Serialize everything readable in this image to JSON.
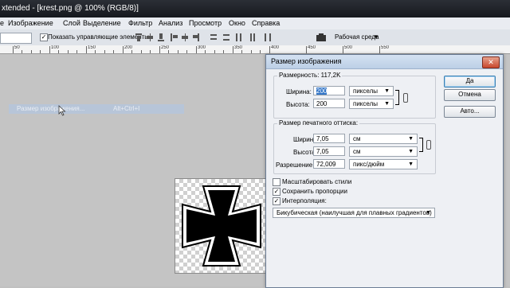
{
  "window": {
    "title": "xtended - [krest.png @ 100% (RGB/8)]"
  },
  "menu": [
    "Изображение",
    "Слой",
    "Выделение",
    "Фильтр",
    "Анализ",
    "Просмотр",
    "Окно",
    "Справка"
  ],
  "menu_partial_first": "e",
  "options": {
    "show_controls_label": "Показать управляющие элементы",
    "workspace_label": "Рабочая среда"
  },
  "ruler_labels": [
    "50",
    "100",
    "150",
    "200",
    "250",
    "300",
    "350",
    "400",
    "450",
    "500",
    "550"
  ],
  "ghost_menu": {
    "label": "Размер изображения...",
    "shortcut": "Alt+Ctrl+I"
  },
  "dialog": {
    "title": "Размер изображения",
    "pixel_dims_label": "Размерность: 117,2K",
    "width_label": "Ширина:",
    "width_value": "200",
    "width_unit": "пикселы",
    "height_label": "Высота:",
    "height_value": "200",
    "height_unit": "пикселы",
    "print_size_label": "Размер печатного оттиска:",
    "print_width_label": "Ширина:",
    "print_width_value": "7,05",
    "print_width_unit": "см",
    "print_height_label": "Высота:",
    "print_height_value": "7,05",
    "print_height_unit": "см",
    "resolution_label": "Разрешение:",
    "resolution_value": "72,009",
    "resolution_unit": "пикс/дюйм",
    "scale_styles_label": "Масштабировать стили",
    "scale_styles_checked": false,
    "constrain_label": "Сохранить пропорции",
    "constrain_checked": true,
    "resample_label": "Интерполяция:",
    "resample_checked": true,
    "resample_method": "Бикубическая (наилучшая для плавных градиентов)",
    "ok_label": "Да",
    "cancel_label": "Отмена",
    "auto_label": "Авто..."
  },
  "colors": {
    "accent": "#3c7fb1",
    "titlebar": "#1c1f24",
    "canvas": "#c4c4c4"
  }
}
